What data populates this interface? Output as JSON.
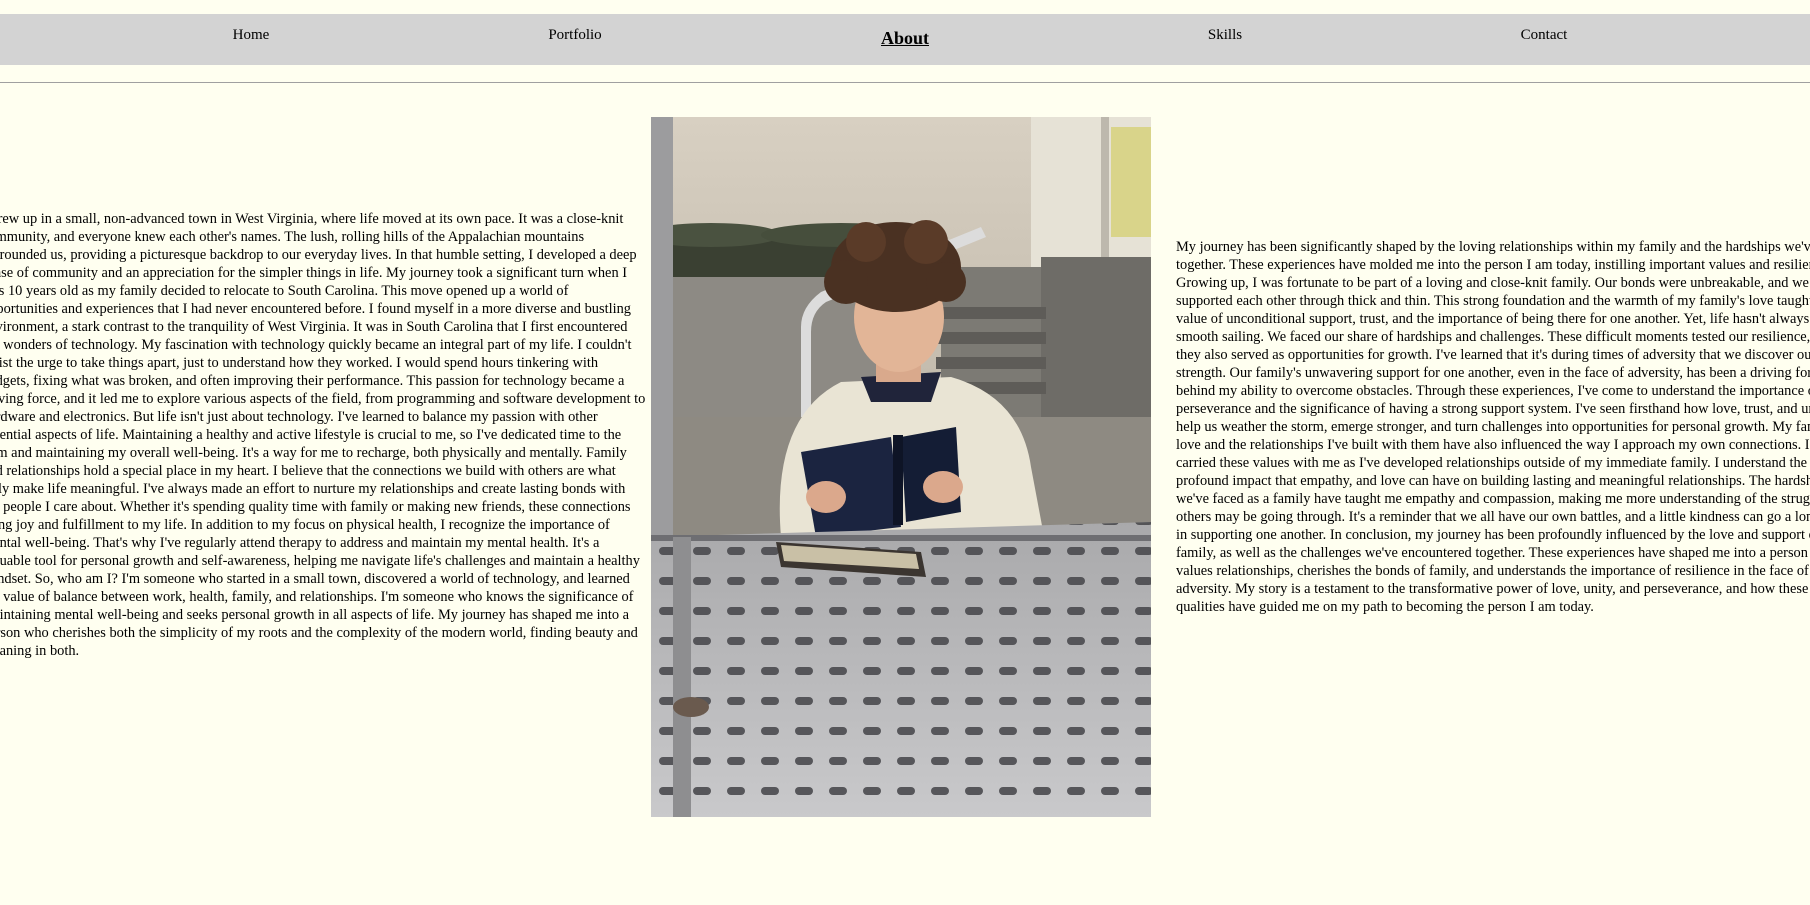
{
  "nav": {
    "items": [
      {
        "label": "Home",
        "active": false
      },
      {
        "label": "Portfolio",
        "active": false
      },
      {
        "label": "About",
        "active": true
      },
      {
        "label": "Skills",
        "active": false
      },
      {
        "label": "Contact",
        "active": false
      }
    ]
  },
  "colors": {
    "page_background": "#fffff0",
    "nav_background": "#d3d3d3"
  },
  "about": {
    "left_text": "I grew up in a small, non-advanced town in West Virginia, where life moved at its own pace. It was a close-knit community, and everyone knew each other's names. The lush, rolling hills of the Appalachian mountains surrounded us, providing a picturesque backdrop to our everyday lives. In that humble setting, I developed a deep sense of community and an appreciation for the simpler things in life. My journey took a significant turn when I was 10 years old as my family decided to relocate to South Carolina. This move opened up a world of opportunities and experiences that I had never encountered before. I found myself in a more diverse and bustling environment, a stark contrast to the tranquility of West Virginia. It was in South Carolina that I first encountered the wonders of technology. My fascination with technology quickly became an integral part of my life. I couldn't resist the urge to take things apart, just to understand how they worked. I would spend hours tinkering with gadgets, fixing what was broken, and often improving their performance. This passion for technology became a driving force, and it led me to explore various aspects of the field, from programming and software development to hardware and electronics. But life isn't just about technology. I've learned to balance my passion with other essential aspects of life. Maintaining a healthy and active lifestyle is crucial to me, so I've dedicated time to the gym and maintaining my overall well-being. It's a way for me to recharge, both physically and mentally. Family and relationships hold a special place in my heart. I believe that the connections we build with others are what truly make life meaningful. I've always made an effort to nurture my relationships and create lasting bonds with the people I care about. Whether it's spending quality time with family or making new friends, these connections bring joy and fulfillment to my life. In addition to my focus on physical health, I recognize the importance of mental well-being. That's why I've regularly attend therapy to address and maintain my mental health. It's a valuable tool for personal growth and self-awareness, helping me navigate life's challenges and maintain a healthy mindset. So, who am I? I'm someone who started in a small town, discovered a world of technology, and learned the value of balance between work, health, family, and relationships. I'm someone who knows the significance of maintaining mental well-being and seeks personal growth in all aspects of life. My journey has shaped me into a person who cherishes both the simplicity of my roots and the complexity of the modern world, finding beauty and meaning in both.",
    "right_text": "My journey has been significantly shaped by the loving relationships within my family and the hardships we've faced together. These experiences have molded me into the person I am today, instilling important values and resilience. Growing up, I was fortunate to be part of a loving and close-knit family. Our bonds were unbreakable, and we supported each other through thick and thin. This strong foundation and the warmth of my family's love taught me the value of unconditional support, trust, and the importance of being there for one another. Yet, life hasn't always been smooth sailing. We faced our share of hardships and challenges. These difficult moments tested our resilience, but they also served as opportunities for growth. I've learned that it's during times of adversity that we discover our true strength. Our family's unwavering support for one another, even in the face of adversity, has been a driving force behind my ability to overcome obstacles. Through these experiences, I've come to understand the importance of perseverance and the significance of having a strong support system. I've seen firsthand how love, trust, and unity can help us weather the storm, emerge stronger, and turn challenges into opportunities for personal growth. My family's love and the relationships I've built with them have also influenced the way I approach my own connections. I've carried these values with me as I've developed relationships outside of my immediate family. I understand the profound impact that empathy, and love can have on building lasting and meaningful relationships. The hardships we've faced as a family have taught me empathy and compassion, making me more understanding of the struggles others may be going through. It's a reminder that we all have our own battles, and a little kindness can go a long way in supporting one another. In conclusion, my journey has been profoundly influenced by the love and support of my family, as well as the challenges we've encountered together. These experiences have shaped me into a person who values relationships, cherishes the bonds of family, and understands the importance of resilience in the face of adversity. My story is a testament to the transformative power of love, unity, and perseverance, and how these qualities have guided me on my path to becoming the person I am today."
  },
  "photo": {
    "icon": "person-reading-photo"
  }
}
